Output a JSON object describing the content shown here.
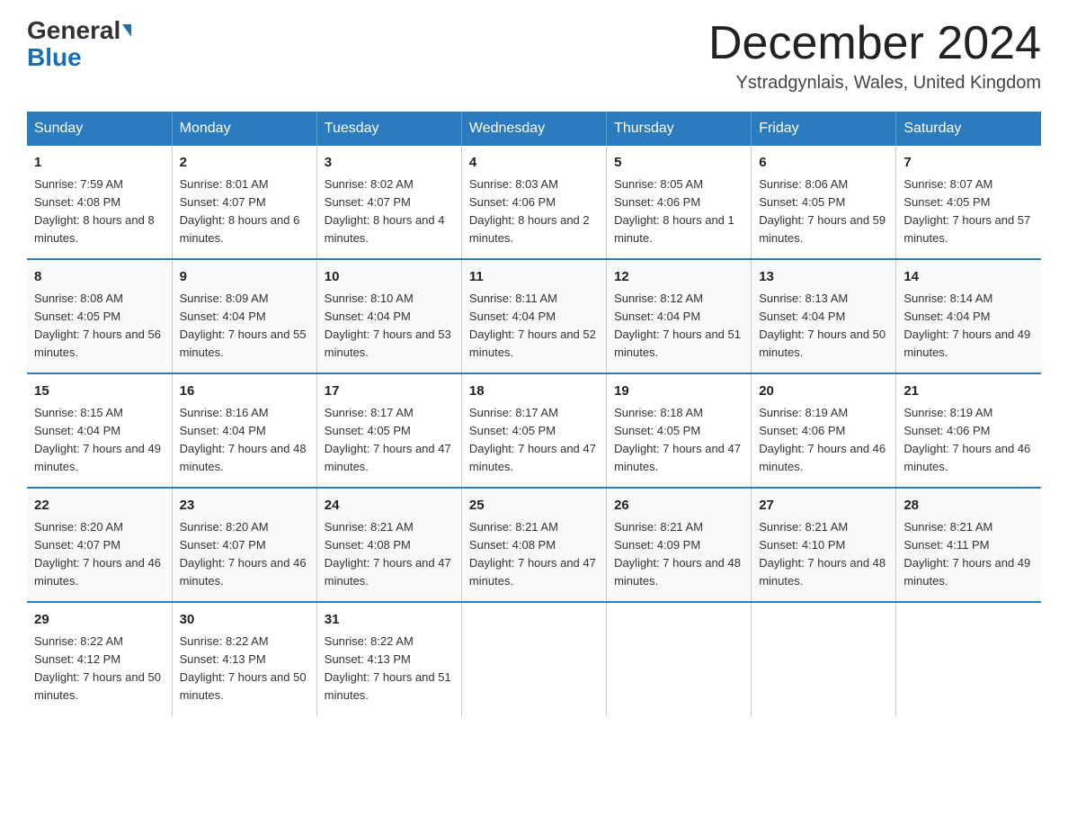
{
  "header": {
    "logo_general": "General",
    "logo_blue": "Blue",
    "month_title": "December 2024",
    "location": "Ystradgynlais, Wales, United Kingdom"
  },
  "days_of_week": [
    "Sunday",
    "Monday",
    "Tuesday",
    "Wednesday",
    "Thursday",
    "Friday",
    "Saturday"
  ],
  "weeks": [
    [
      {
        "day": "1",
        "sunrise": "7:59 AM",
        "sunset": "4:08 PM",
        "daylight": "8 hours and 8 minutes."
      },
      {
        "day": "2",
        "sunrise": "8:01 AM",
        "sunset": "4:07 PM",
        "daylight": "8 hours and 6 minutes."
      },
      {
        "day": "3",
        "sunrise": "8:02 AM",
        "sunset": "4:07 PM",
        "daylight": "8 hours and 4 minutes."
      },
      {
        "day": "4",
        "sunrise": "8:03 AM",
        "sunset": "4:06 PM",
        "daylight": "8 hours and 2 minutes."
      },
      {
        "day": "5",
        "sunrise": "8:05 AM",
        "sunset": "4:06 PM",
        "daylight": "8 hours and 1 minute."
      },
      {
        "day": "6",
        "sunrise": "8:06 AM",
        "sunset": "4:05 PM",
        "daylight": "7 hours and 59 minutes."
      },
      {
        "day": "7",
        "sunrise": "8:07 AM",
        "sunset": "4:05 PM",
        "daylight": "7 hours and 57 minutes."
      }
    ],
    [
      {
        "day": "8",
        "sunrise": "8:08 AM",
        "sunset": "4:05 PM",
        "daylight": "7 hours and 56 minutes."
      },
      {
        "day": "9",
        "sunrise": "8:09 AM",
        "sunset": "4:04 PM",
        "daylight": "7 hours and 55 minutes."
      },
      {
        "day": "10",
        "sunrise": "8:10 AM",
        "sunset": "4:04 PM",
        "daylight": "7 hours and 53 minutes."
      },
      {
        "day": "11",
        "sunrise": "8:11 AM",
        "sunset": "4:04 PM",
        "daylight": "7 hours and 52 minutes."
      },
      {
        "day": "12",
        "sunrise": "8:12 AM",
        "sunset": "4:04 PM",
        "daylight": "7 hours and 51 minutes."
      },
      {
        "day": "13",
        "sunrise": "8:13 AM",
        "sunset": "4:04 PM",
        "daylight": "7 hours and 50 minutes."
      },
      {
        "day": "14",
        "sunrise": "8:14 AM",
        "sunset": "4:04 PM",
        "daylight": "7 hours and 49 minutes."
      }
    ],
    [
      {
        "day": "15",
        "sunrise": "8:15 AM",
        "sunset": "4:04 PM",
        "daylight": "7 hours and 49 minutes."
      },
      {
        "day": "16",
        "sunrise": "8:16 AM",
        "sunset": "4:04 PM",
        "daylight": "7 hours and 48 minutes."
      },
      {
        "day": "17",
        "sunrise": "8:17 AM",
        "sunset": "4:05 PM",
        "daylight": "7 hours and 47 minutes."
      },
      {
        "day": "18",
        "sunrise": "8:17 AM",
        "sunset": "4:05 PM",
        "daylight": "7 hours and 47 minutes."
      },
      {
        "day": "19",
        "sunrise": "8:18 AM",
        "sunset": "4:05 PM",
        "daylight": "7 hours and 47 minutes."
      },
      {
        "day": "20",
        "sunrise": "8:19 AM",
        "sunset": "4:06 PM",
        "daylight": "7 hours and 46 minutes."
      },
      {
        "day": "21",
        "sunrise": "8:19 AM",
        "sunset": "4:06 PM",
        "daylight": "7 hours and 46 minutes."
      }
    ],
    [
      {
        "day": "22",
        "sunrise": "8:20 AM",
        "sunset": "4:07 PM",
        "daylight": "7 hours and 46 minutes."
      },
      {
        "day": "23",
        "sunrise": "8:20 AM",
        "sunset": "4:07 PM",
        "daylight": "7 hours and 46 minutes."
      },
      {
        "day": "24",
        "sunrise": "8:21 AM",
        "sunset": "4:08 PM",
        "daylight": "7 hours and 47 minutes."
      },
      {
        "day": "25",
        "sunrise": "8:21 AM",
        "sunset": "4:08 PM",
        "daylight": "7 hours and 47 minutes."
      },
      {
        "day": "26",
        "sunrise": "8:21 AM",
        "sunset": "4:09 PM",
        "daylight": "7 hours and 48 minutes."
      },
      {
        "day": "27",
        "sunrise": "8:21 AM",
        "sunset": "4:10 PM",
        "daylight": "7 hours and 48 minutes."
      },
      {
        "day": "28",
        "sunrise": "8:21 AM",
        "sunset": "4:11 PM",
        "daylight": "7 hours and 49 minutes."
      }
    ],
    [
      {
        "day": "29",
        "sunrise": "8:22 AM",
        "sunset": "4:12 PM",
        "daylight": "7 hours and 50 minutes."
      },
      {
        "day": "30",
        "sunrise": "8:22 AM",
        "sunset": "4:13 PM",
        "daylight": "7 hours and 50 minutes."
      },
      {
        "day": "31",
        "sunrise": "8:22 AM",
        "sunset": "4:13 PM",
        "daylight": "7 hours and 51 minutes."
      },
      {
        "day": "",
        "sunrise": "",
        "sunset": "",
        "daylight": ""
      },
      {
        "day": "",
        "sunrise": "",
        "sunset": "",
        "daylight": ""
      },
      {
        "day": "",
        "sunrise": "",
        "sunset": "",
        "daylight": ""
      },
      {
        "day": "",
        "sunrise": "",
        "sunset": "",
        "daylight": ""
      }
    ]
  ]
}
